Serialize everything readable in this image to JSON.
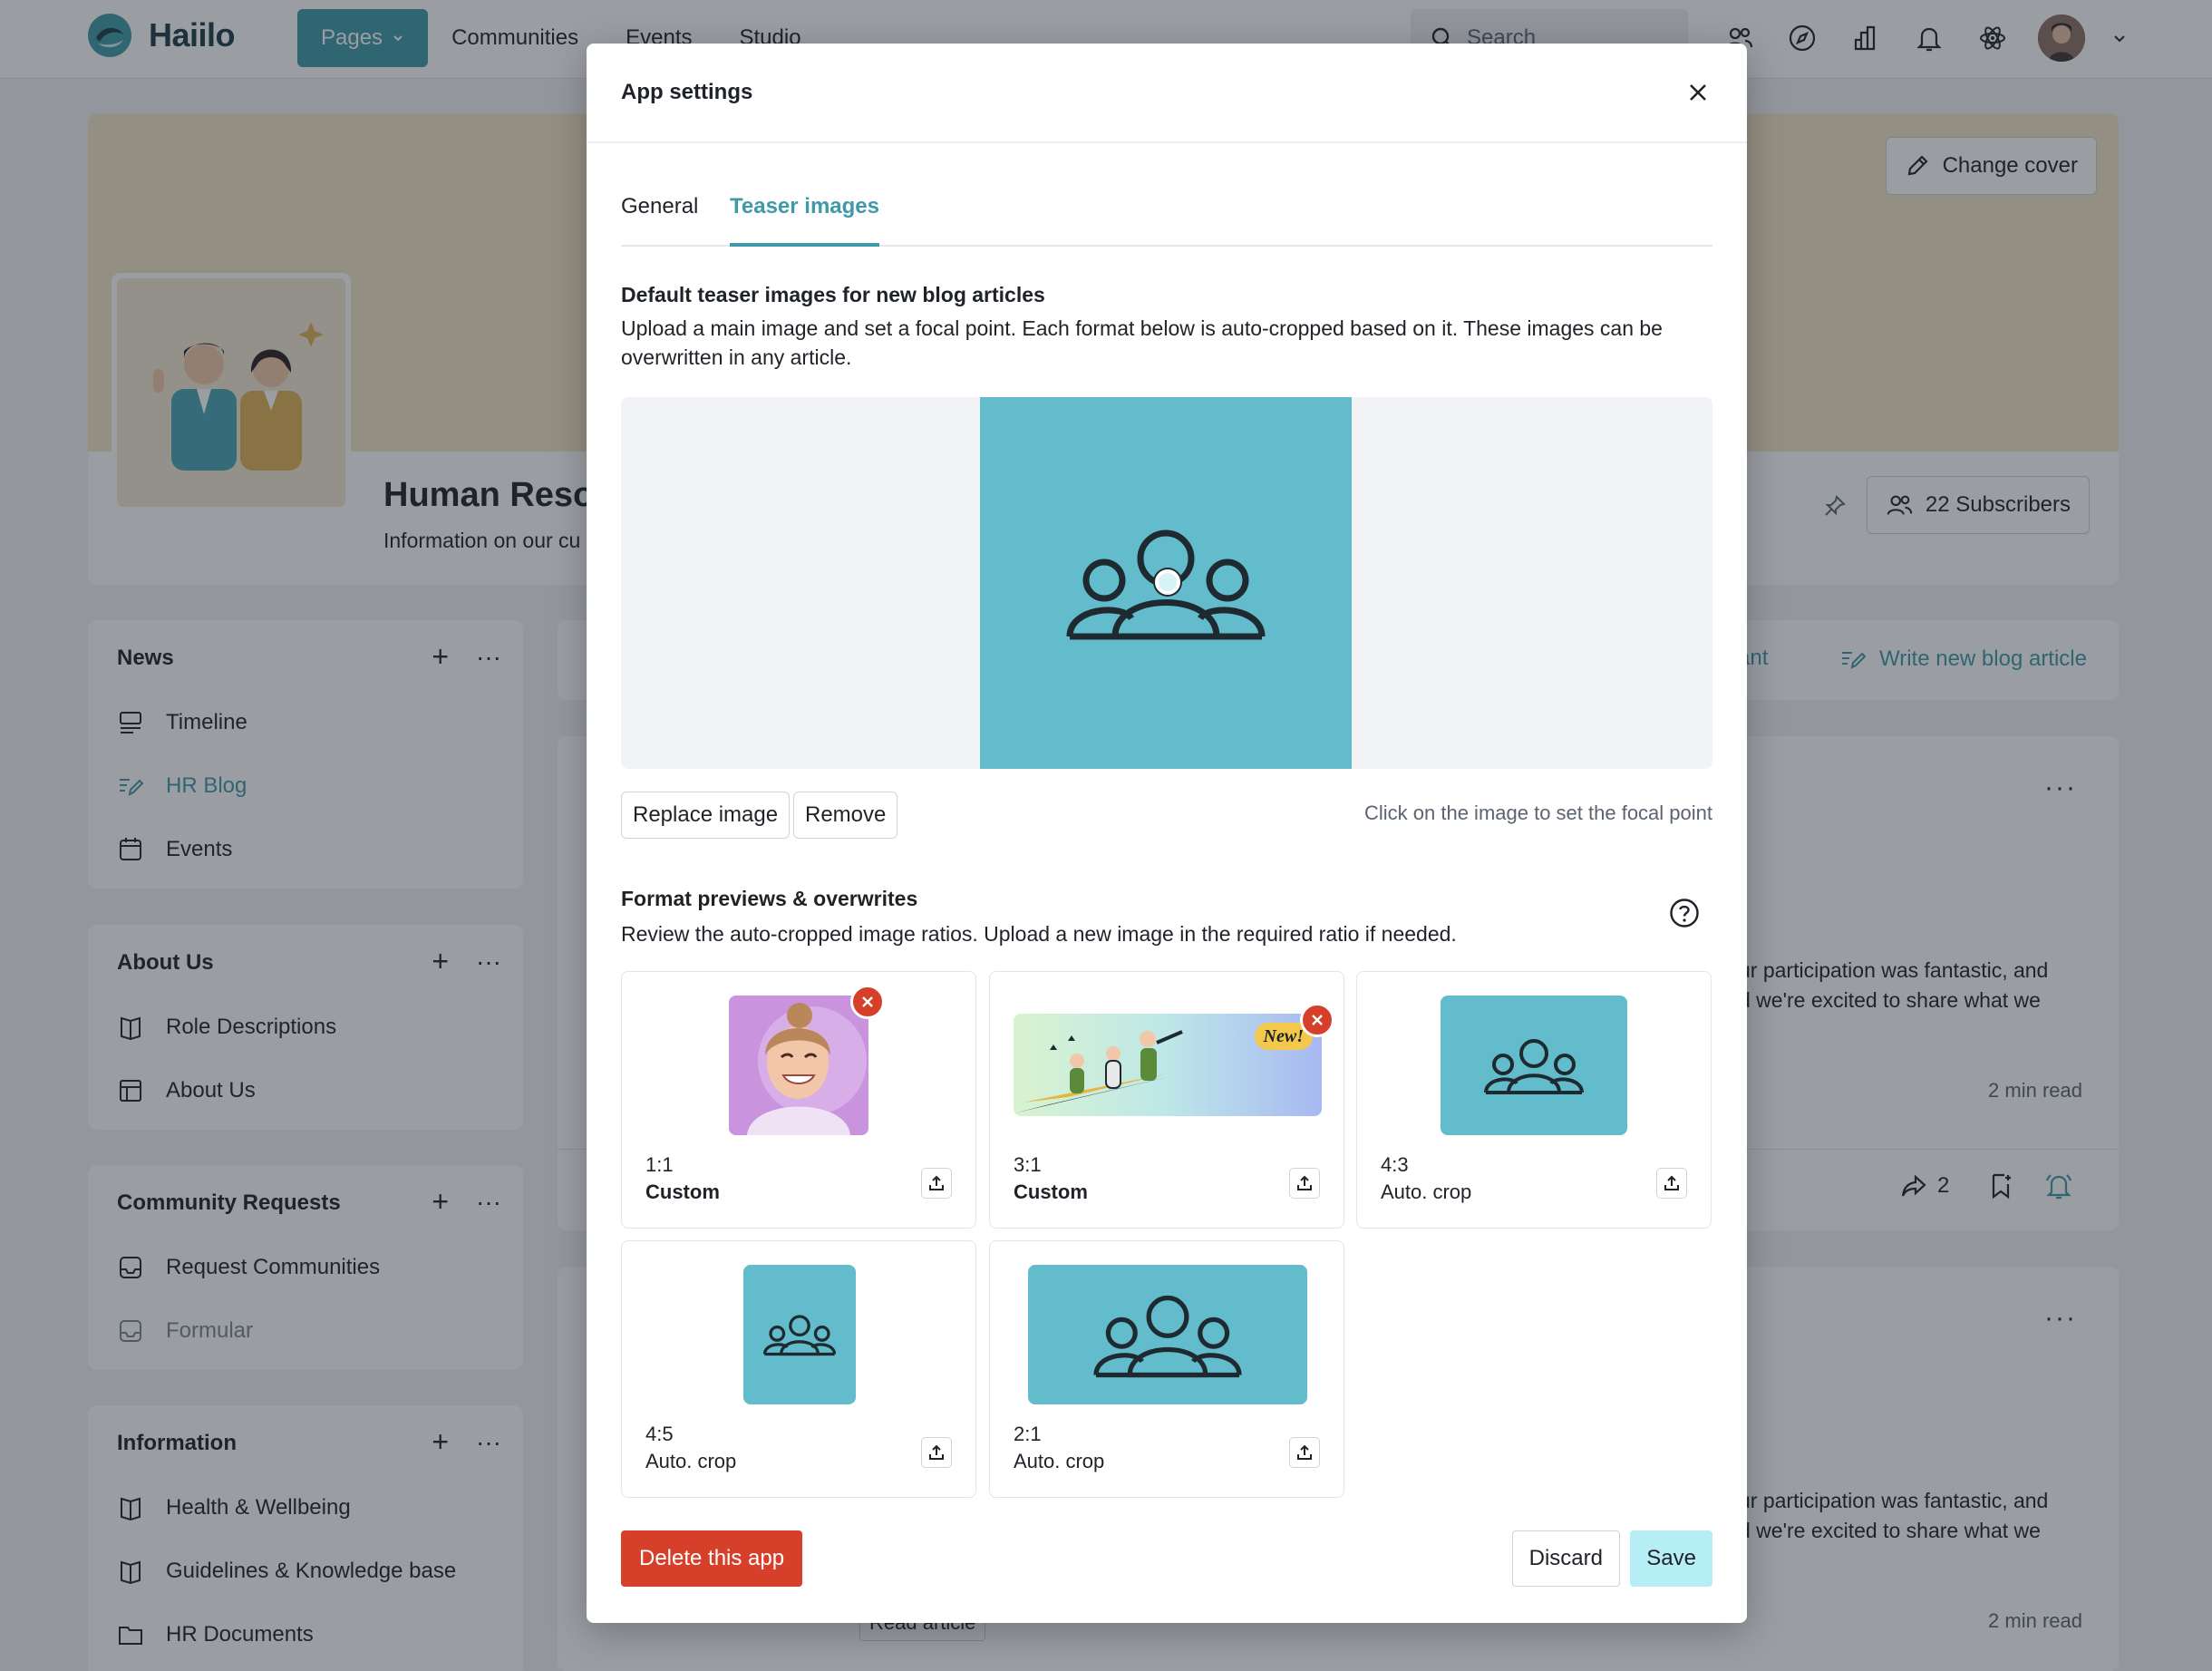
{
  "app": {
    "name": "Haiilo",
    "accent": "#3f99a8"
  },
  "nav": {
    "items": [
      {
        "label": "Pages"
      },
      {
        "label": "Communities"
      },
      {
        "label": "Events"
      },
      {
        "label": "Studio"
      }
    ],
    "search_placeholder": "Search"
  },
  "page": {
    "change_cover": "Change cover",
    "title": "Human Resou",
    "subtitle": "Information on our cu",
    "subscribers": "22 Subscribers"
  },
  "sidebar": {
    "sections": [
      {
        "title": "News",
        "items": [
          "Timeline",
          "HR Blog",
          "Events"
        ]
      },
      {
        "title": "About Us",
        "items": [
          "Role Descriptions",
          "About Us"
        ]
      },
      {
        "title": "Community Requests",
        "items": [
          "Request Communities",
          "Formular"
        ]
      },
      {
        "title": "Information",
        "items": [
          "Health & Wellbeing",
          "Guidelines & Knowledge base",
          "HR Documents"
        ]
      }
    ]
  },
  "feed": {
    "assistant_link": "istant",
    "write_link": "Write new blog article",
    "posts": [
      {
        "line1": "ur participation was fantastic, and",
        "line2": "d we're excited to share what we",
        "read_time": "2 min read",
        "share_count": "2"
      },
      {
        "line1": "ur participation was fantastic, and",
        "line2": "d we're excited to share what we",
        "read_time": "2 min read",
        "read_article": "Read article"
      }
    ]
  },
  "modal": {
    "title": "App settings",
    "tabs": [
      {
        "label": "General"
      },
      {
        "label": "Teaser images"
      }
    ],
    "section1": {
      "title": "Default teaser images for new blog articles",
      "desc": "Upload a main image and set a focal point. Each format below is auto-cropped based on it. These images can be overwritten in any article."
    },
    "replace_btn": "Replace image",
    "remove_btn": "Remove",
    "hint": "Click on the image to set the focal point",
    "section2": {
      "title": "Format previews & overwrites",
      "desc": "Review the auto-cropped image ratios. Upload a new image in the required ratio if needed."
    },
    "formats": [
      {
        "ratio": "1:1",
        "kind": "Custom"
      },
      {
        "ratio": "3:1",
        "kind": "Custom",
        "badge": "New!"
      },
      {
        "ratio": "4:3",
        "kind": "Auto. crop"
      },
      {
        "ratio": "4:5",
        "kind": "Auto. crop"
      },
      {
        "ratio": "2:1",
        "kind": "Auto. crop"
      }
    ],
    "delete_btn": "Delete this app",
    "discard_btn": "Discard",
    "save_btn": "Save"
  }
}
